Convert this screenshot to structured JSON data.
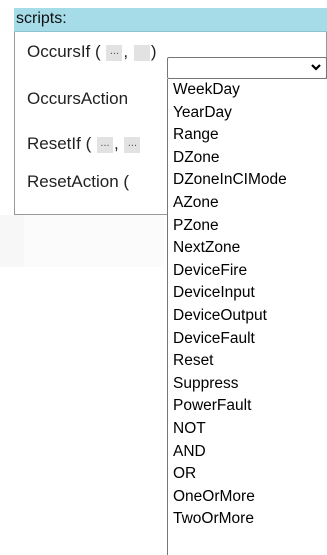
{
  "header": {
    "title": "scripts:"
  },
  "rows": [
    {
      "label": "OccursIf (",
      "has_slots": true,
      "slot1": "...",
      "sep": ",",
      "close": ")"
    },
    {
      "label": "OccursAction",
      "has_slots": false
    },
    {
      "label": "ResetIf (",
      "has_slots": true,
      "slot1": "...",
      "sep": ",",
      "slot2": "..."
    },
    {
      "label": "ResetAction (",
      "has_slots": false
    }
  ],
  "select": {
    "selected": "",
    "icon": "chevron-down-icon",
    "options": [
      "WeekDay",
      "YearDay",
      "Range",
      "DZone",
      "DZoneInCIMode",
      "AZone",
      "PZone",
      "NextZone",
      "DeviceFire",
      "DeviceInput",
      "DeviceOutput",
      "DeviceFault",
      "Reset",
      "Suppress",
      "PowerFault",
      "NOT",
      "AND",
      "OR",
      "OneOrMore",
      "TwoOrMore"
    ]
  },
  "colors": {
    "header_bg": "#a6dbe8",
    "slot_bg": "#e2e2e2"
  }
}
